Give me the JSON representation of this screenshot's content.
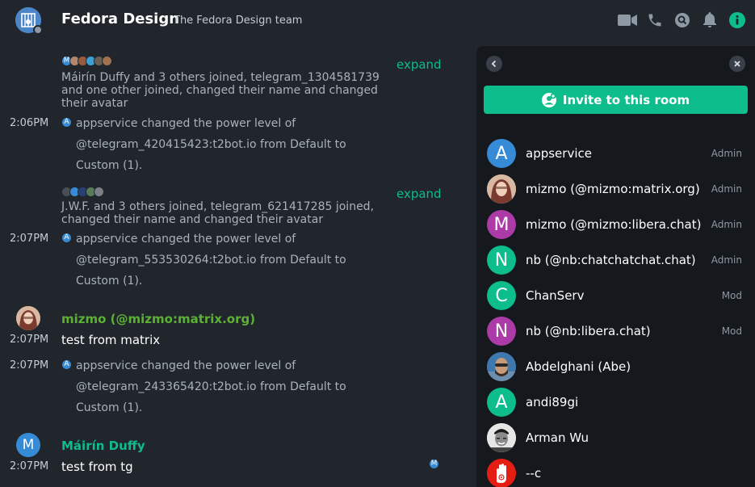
{
  "header": {
    "room_name": "Fedora Design",
    "topic": "The Fedora Design team"
  },
  "timeline": {
    "events": [
      {
        "summary_line1": "Máirín Duffy and 3 others joined, telegram_1304581739",
        "summary_line2": "and one other joined, changed their name and changed",
        "summary_line3": "their avatar",
        "expand": "expand",
        "mini_avatars": [
          "M",
          "",
          "",
          "",
          "",
          ""
        ]
      },
      {
        "time": "2:06PM",
        "line1": "appservice changed the power level of",
        "line2": "@telegram_420415423:t2bot.io from Default to",
        "line3": "Custom (1)."
      },
      {
        "summary_line1": "J.W.F. and 3 others joined, telegram_621417285 joined,",
        "summary_line2": "changed their name and changed their avatar",
        "expand": "expand"
      },
      {
        "time": "2:07PM",
        "line1": "appservice changed the power level of",
        "line2": "@telegram_553530264:t2bot.io from Default to",
        "line3": "Custom (1)."
      },
      {
        "sender": "mizmo (@mizmo:matrix.org)",
        "time": "2:07PM",
        "body": "test from matrix"
      },
      {
        "time": "2:07PM",
        "line1": "appservice changed the power level of",
        "line2": "@telegram_243365420:t2bot.io from Default to",
        "line3": "Custom (1)."
      },
      {
        "sender": "Máirín Duffy",
        "avatar_letter": "M",
        "time": "2:07PM",
        "body": "test from tg",
        "read_receipt": "M"
      }
    ],
    "mini_A": "A"
  },
  "panel": {
    "invite_label": "Invite to this room",
    "members": [
      {
        "name": "appservice",
        "role": "Admin",
        "letter": "A",
        "color": "#368bd6"
      },
      {
        "name": "mizmo (@mizmo:matrix.org)",
        "role": "Admin",
        "letter": "",
        "color": "#b3876e"
      },
      {
        "name": "mizmo (@mizmo:libera.chat)",
        "role": "Admin",
        "letter": "M",
        "color": "#ac3ba8"
      },
      {
        "name": "nb (@nb:chatchatchat.chat)",
        "role": "Admin",
        "letter": "N",
        "color": "#0dbd8b"
      },
      {
        "name": "ChanServ",
        "role": "Mod",
        "letter": "C",
        "color": "#0dbd8b"
      },
      {
        "name": "nb (@nb:libera.chat)",
        "role": "Mod",
        "letter": "N",
        "color": "#ac3ba8"
      },
      {
        "name": "Abdelghani (Abe)",
        "role": "",
        "letter": "",
        "color": "#3b6e9c"
      },
      {
        "name": "andi89gi",
        "role": "",
        "letter": "A",
        "color": "#0dbd8b"
      },
      {
        "name": "Arman Wu",
        "role": "",
        "letter": "",
        "color": "#d9d9d9"
      },
      {
        "name": "--c",
        "role": "",
        "letter": "",
        "color": "#e41e13"
      }
    ]
  },
  "colors": {
    "accent": "#0dbd8b",
    "background": "#21262c",
    "panel": "#15191e",
    "sender_mizmo": "#5cb135",
    "sender_mairin": "#0dbd8b"
  }
}
